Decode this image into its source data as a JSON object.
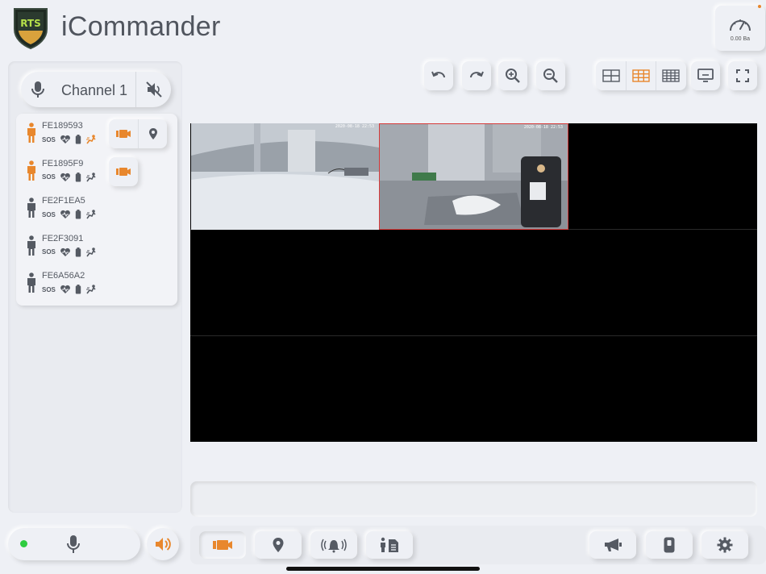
{
  "app": {
    "title": "iCommander",
    "logo_text": "RTS"
  },
  "gauge": {
    "value_label": "0.00 Ba"
  },
  "channel": {
    "label": "Channel 1"
  },
  "devices": [
    {
      "id": "FE189593",
      "sos": "SOS",
      "active": true,
      "actions": [
        "video-icon",
        "location-pin-icon"
      ]
    },
    {
      "id": "FE1895F9",
      "sos": "SOS",
      "active": true,
      "actions": [
        "video-icon"
      ]
    },
    {
      "id": "FE2F1EA5",
      "sos": "SOS",
      "active": false,
      "actions": []
    },
    {
      "id": "FE2F3091",
      "sos": "SOS",
      "active": false,
      "actions": []
    },
    {
      "id": "FE6A56A2",
      "sos": "SOS",
      "active": false,
      "actions": []
    }
  ],
  "toolbar": {
    "icons": [
      "undo-icon",
      "redo-icon",
      "zoom-in-icon",
      "zoom-out-icon",
      "grid-2x2-icon",
      "grid-3x3-icon",
      "grid-4x4-icon",
      "monitor-icon",
      "fullscreen-icon"
    ],
    "selected_layout": "grid-3x3"
  },
  "video": {
    "tiles": [
      {
        "timestamp": "2020-08-18 22:53",
        "selected": false
      },
      {
        "timestamp": "2020-08-18 22:53",
        "selected": true
      }
    ]
  },
  "bottom_bar": {
    "icons": [
      "video-icon",
      "location-pin-icon",
      "alarm-bell-icon",
      "person-report-icon",
      "megaphone-icon",
      "device-icon",
      "gear-icon"
    ],
    "active": "video-icon"
  },
  "colors": {
    "accent": "#e8872d",
    "neutral": "#555a63",
    "selected_border": "#d63a3a",
    "online": "#2ecc40"
  }
}
